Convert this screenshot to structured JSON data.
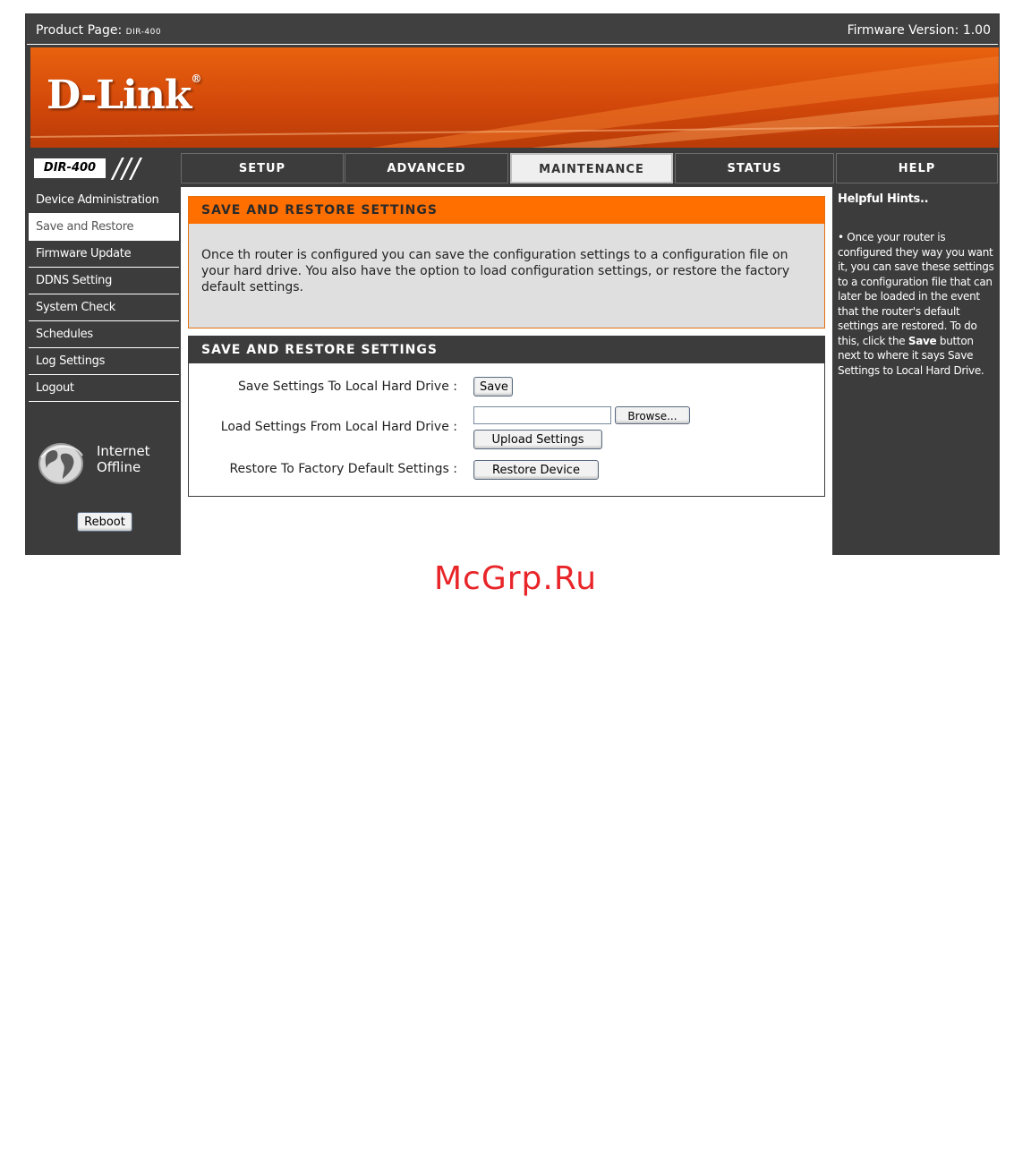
{
  "topbar": {
    "product_label": "Product Page: ",
    "product_model": "DIR-400",
    "firmware": "Firmware Version: 1.00"
  },
  "brand": {
    "logo": "D-Link",
    "accent": "#ff6f00",
    "dark": "#3c3c3c"
  },
  "model_badge": "DIR-400",
  "tabs": [
    {
      "label": "SETUP",
      "active": false
    },
    {
      "label": "ADVANCED",
      "active": false
    },
    {
      "label": "MAINTENANCE",
      "active": true
    },
    {
      "label": "STATUS",
      "active": false
    },
    {
      "label": "HELP",
      "active": false
    }
  ],
  "sidebar": {
    "items": [
      {
        "label": "Device Administration",
        "active": false
      },
      {
        "label": "Save and Restore",
        "active": true
      },
      {
        "label": "Firmware Update",
        "active": false
      },
      {
        "label": "DDNS Setting",
        "active": false
      },
      {
        "label": "System Check",
        "active": false
      },
      {
        "label": "Schedules",
        "active": false
      },
      {
        "label": "Log Settings",
        "active": false
      },
      {
        "label": "Logout",
        "active": false
      }
    ],
    "status_line1": "Internet",
    "status_line2": "Offline",
    "status_icon": "globe-icon",
    "reboot_label": "Reboot"
  },
  "intro": {
    "title": "SAVE AND RESTORE SETTINGS",
    "text": "Once th router is configured you can save the configuration settings to a configuration file on your hard drive. You also have the option to load configuration settings, or restore the factory default settings."
  },
  "settings": {
    "title": "SAVE AND RESTORE SETTINGS",
    "save_label": "Save Settings To Local Hard Drive :",
    "save_button": "Save",
    "load_label": "Load Settings From Local Hard Drive :",
    "file_value": "",
    "browse_button": "Browse...",
    "upload_button": "Upload Settings",
    "restore_label": "Restore To Factory Default Settings :",
    "restore_button": "Restore Device"
  },
  "help": {
    "title": "Helpful Hints..",
    "bullet": "• Once your router is configured they way you want it, you can save these settings to a configuration file that can later be loaded in the event that the router's default settings are restored. To do this, click the ",
    "bold": "Save",
    "rest": " button next to where it says Save Settings to Local Hard Drive."
  },
  "watermark": "McGrp.Ru"
}
